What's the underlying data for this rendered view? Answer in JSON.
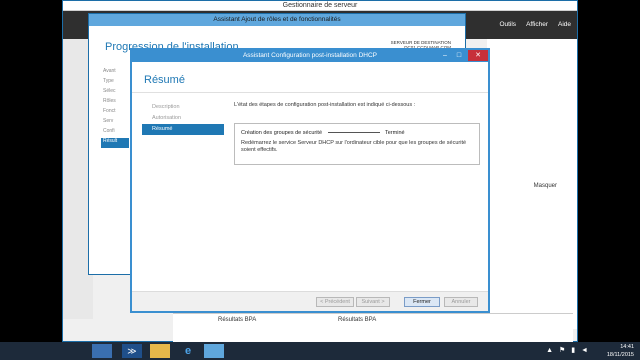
{
  "server_manager": {
    "title": "Gestionnaire de serveur",
    "menu": [
      "Outils",
      "Afficher",
      "Aide"
    ],
    "masquer_label": "Masquer",
    "bpa_labels": [
      "Résultats BPA",
      "Résultats BPA"
    ]
  },
  "roles_wizard": {
    "title": "Assistant Ajout de rôles et de fonctionnalités",
    "heading": "Progression de l'installation",
    "destination_label": "SERVEUR DE DESTINATION",
    "destination_value": "DC01.CCDLMAR.COM",
    "nav": [
      "Avant",
      "Type",
      "Sélec",
      "Rôles",
      "Fonct",
      "Serv",
      "Confi",
      "Résult"
    ]
  },
  "dhcp_wizard": {
    "title": "Assistant Configuration post-installation DHCP",
    "heading": "Résumé",
    "nav": [
      "Description",
      "Autorisation",
      "Résumé"
    ],
    "intro": "L'état des étapes de configuration post-installation est indiqué ci-dessous :",
    "step_label": "Création des groupes de sécurité",
    "step_status": "Terminé",
    "message": "Redémarrez le service Serveur DHCP sur l'ordinateur cible pour que les groupes de sécurité soient effectifs.",
    "buttons": {
      "previous": "< Précédent",
      "next": "Suivant >",
      "close": "Fermer",
      "cancel": "Annuler"
    }
  },
  "taskbar": {
    "time": "14:41",
    "date": "18/11/2015"
  },
  "colors": {
    "accent": "#1f78b4",
    "title_bar": "#3a8fd0",
    "close_button": "#c7303a",
    "taskbar": "#1d2a3a"
  }
}
